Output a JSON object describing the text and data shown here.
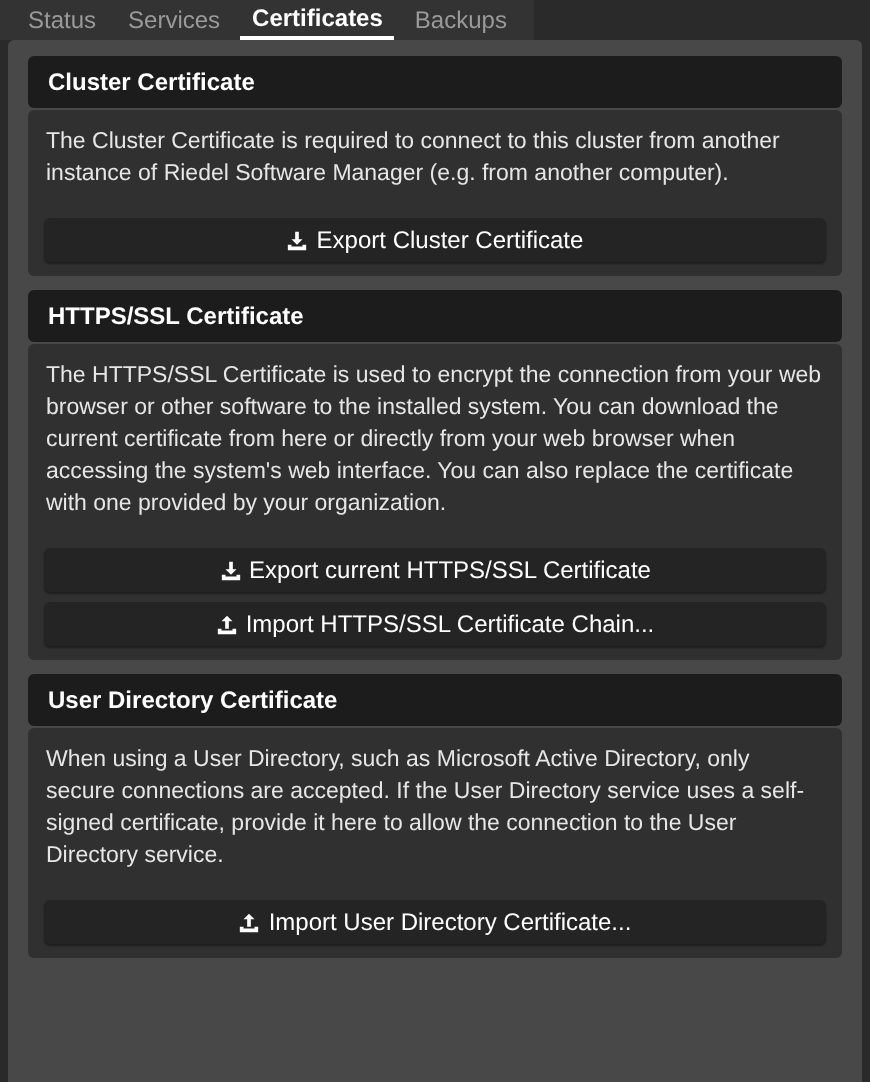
{
  "tabs": [
    {
      "label": "Status",
      "selected": false
    },
    {
      "label": "Services",
      "selected": false
    },
    {
      "label": "Certificates",
      "selected": true
    },
    {
      "label": "Backups",
      "selected": false
    }
  ],
  "sections": [
    {
      "title": "Cluster Certificate",
      "description": "The Cluster Certificate is required to connect to this cluster from another instance of Riedel Software Manager (e.g. from another computer).",
      "buttons": [
        {
          "kind": "export",
          "label": "Export Cluster Certificate"
        }
      ]
    },
    {
      "title": "HTTPS/SSL Certificate",
      "description": "The HTTPS/SSL Certificate is used to encrypt the connection from your web browser or other software to the installed system. You can download the current certificate from here or directly from your web browser when accessing the system's web interface. You can also replace the certificate with one provided by your organization.",
      "buttons": [
        {
          "kind": "export",
          "label": "Export current HTTPS/SSL Certificate"
        },
        {
          "kind": "import",
          "label": "Import HTTPS/SSL Certificate Chain..."
        }
      ]
    },
    {
      "title": "User Directory Certificate",
      "description": "When using a User Directory, such as Microsoft Active Directory, only secure connections are accepted. If the User Directory service uses a self-signed certificate, provide it here to allow the connection to the User Directory service.",
      "buttons": [
        {
          "kind": "import",
          "label": "Import User Directory Certificate..."
        }
      ]
    }
  ]
}
